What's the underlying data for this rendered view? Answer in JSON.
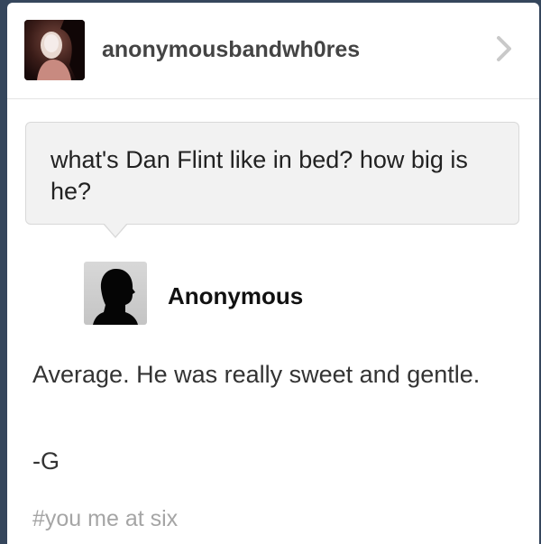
{
  "post": {
    "username": "anonymousbandwh0res",
    "question": "what's Dan Flint like in bed? how big is he?",
    "asker_name": "Anonymous",
    "answer": "Average. He was really sweet and gentle.",
    "signoff": "-G",
    "tags": [
      "#you me at six"
    ]
  },
  "icons": {
    "chevron": "chevron-right-icon",
    "asker_avatar": "anonymous-silhouette-icon"
  },
  "colors": {
    "background": "#35465c",
    "card": "#ffffff",
    "bubble": "#f2f2f2",
    "tag": "#a5a5a5"
  }
}
